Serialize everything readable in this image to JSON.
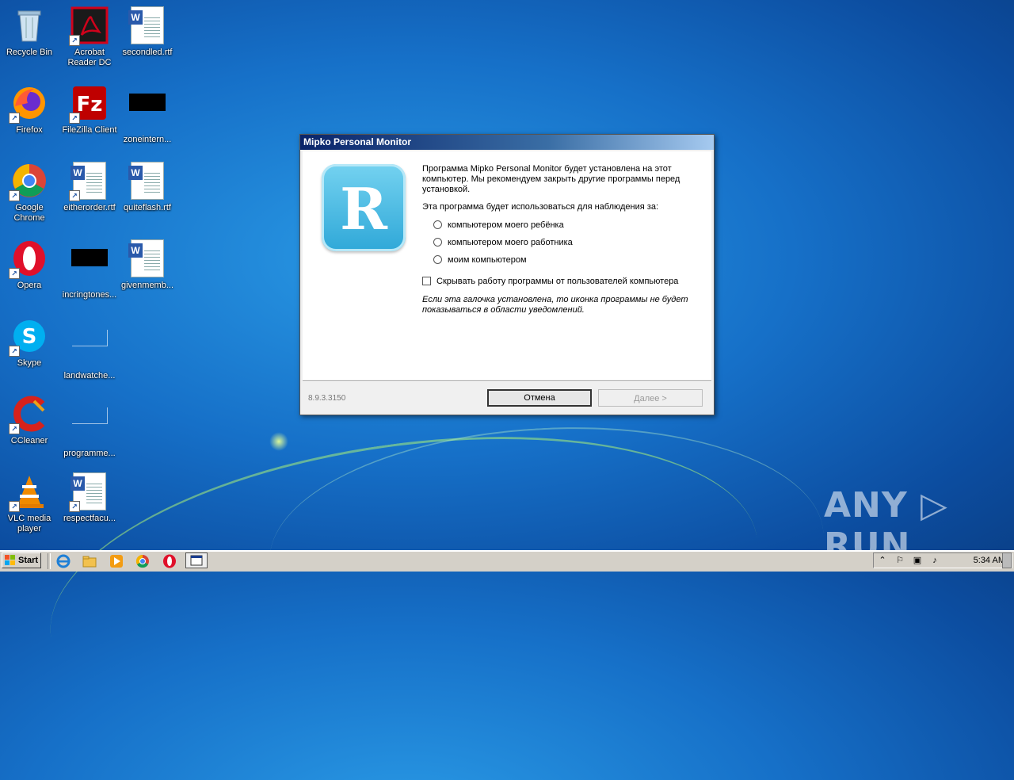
{
  "desktop": {
    "icons": [
      {
        "label": "Recycle Bin"
      },
      {
        "label": "Acrobat Reader DC"
      },
      {
        "label": "secondled.rtf"
      },
      {
        "label": "Firefox"
      },
      {
        "label": "FileZilla Client"
      },
      {
        "label": "zoneintern..."
      },
      {
        "label": "Google Chrome"
      },
      {
        "label": "eitherorder.rtf"
      },
      {
        "label": "quiteflash.rtf"
      },
      {
        "label": "Opera"
      },
      {
        "label": "incringtones..."
      },
      {
        "label": "givenmemb..."
      },
      {
        "label": "Skype"
      },
      {
        "label": "landwatche..."
      },
      {
        "label": "CCleaner"
      },
      {
        "label": "programme..."
      },
      {
        "label": "VLC media player"
      },
      {
        "label": "respectfacu..."
      }
    ]
  },
  "dialog": {
    "title": "Mipko Personal Monitor",
    "intro": "Программа Mipko Personal Monitor будет установлена на этот компьютер. Мы рекомендуем закрыть другие программы перед установкой.",
    "question": "Эта программа будет использоваться для наблюдения за:",
    "options": [
      {
        "label": "компьютером моего ребёнка"
      },
      {
        "label": "компьютером моего работника"
      },
      {
        "label": "моим компьютером"
      }
    ],
    "hide_checkbox_label": "Скрывать работу программы от пользователей компьютера",
    "note": "Если эта галочка установлена, то иконка программы не будет показываться в области уведомлений.",
    "version": "8.9.3.3150",
    "cancel_label": "Отмена",
    "next_label": "Далее >"
  },
  "taskbar": {
    "start_label": "Start",
    "clock": "5:34 AM"
  },
  "watermark": "ANY ▷ RUN",
  "colors": {
    "titlebar_start": "#0a246a",
    "titlebar_end": "#a6caf0",
    "desktop_blue": "#1670c8"
  }
}
